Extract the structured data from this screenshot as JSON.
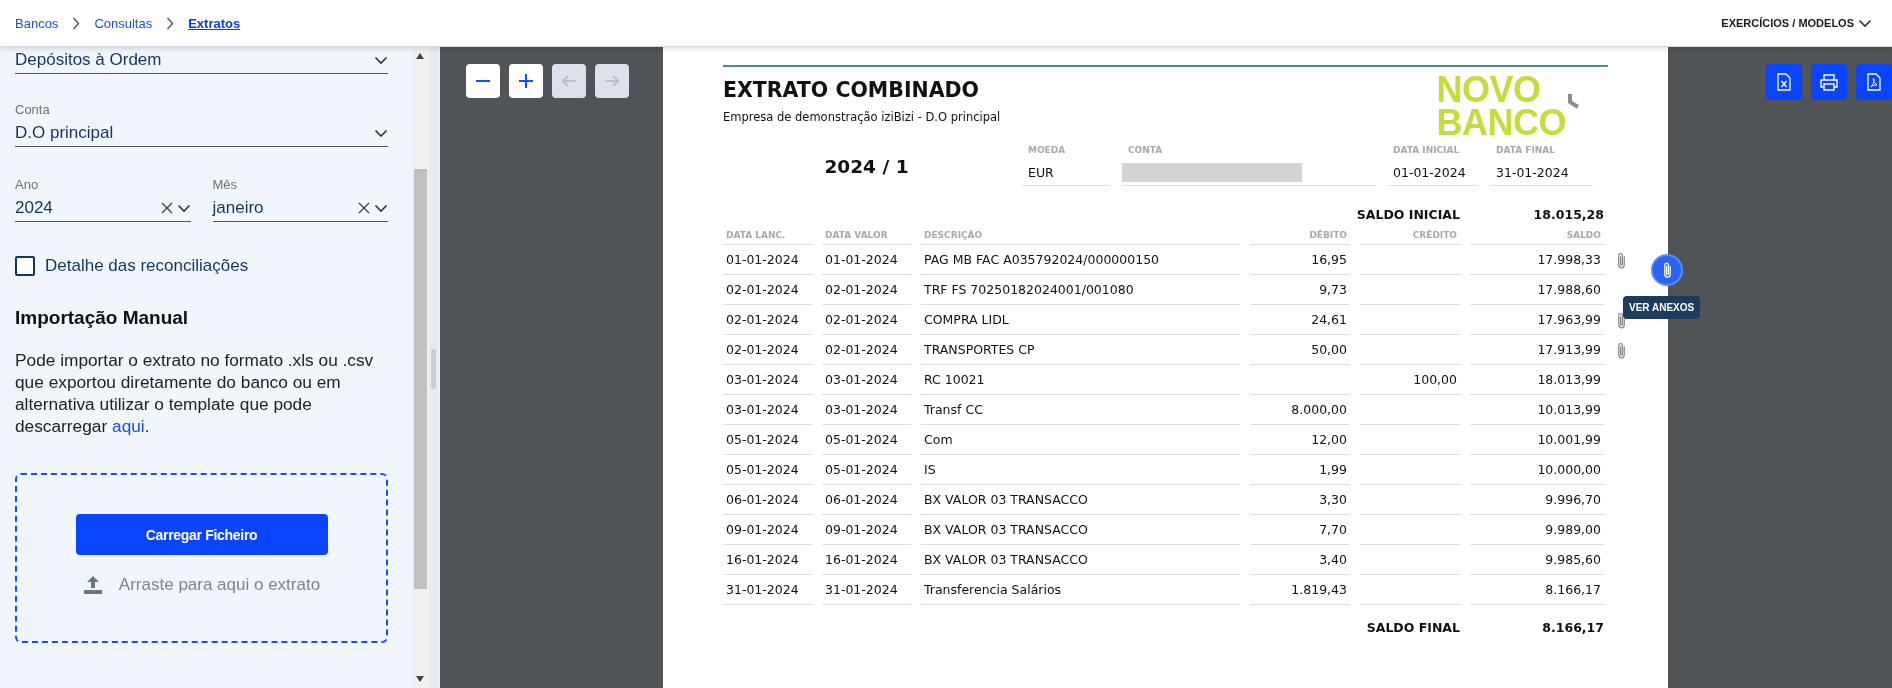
{
  "breadcrumb": [
    {
      "label": "Bancos",
      "selected": false
    },
    {
      "label": "Consultas",
      "selected": false
    },
    {
      "label": "Extratos",
      "selected": true
    }
  ],
  "top_menu": {
    "label": "EXERCÍCIOS / MODELOS"
  },
  "filters": {
    "account_type": {
      "value": "Depósitos à Ordem"
    },
    "account": {
      "label": "Conta",
      "value": "D.O principal"
    },
    "year": {
      "label": "Ano",
      "value": "2024"
    },
    "month": {
      "label": "Mês",
      "value": "janeiro"
    },
    "reconciliation_detail": {
      "label": "Detalhe das reconciliações",
      "checked": false
    }
  },
  "manual_import": {
    "heading": "Importação Manual",
    "text": "Pode importar o extrato no formato .xls ou .csv que exportou diretamente do banco ou em alternativa utilizar o template que pode descarregar ",
    "link": "aqui",
    "text_end": ".",
    "upload_button": "Carregar Ficheiro",
    "drop_hint": "Arraste para aqui o extrato"
  },
  "viewer_toolbar": [
    {
      "kind": "zoom-out",
      "disabled": false
    },
    {
      "kind": "zoom-in",
      "disabled": false
    },
    {
      "kind": "previous",
      "disabled": true
    },
    {
      "kind": "next",
      "disabled": true
    }
  ],
  "export_buttons": [
    {
      "kind": "excel"
    },
    {
      "kind": "print"
    },
    {
      "kind": "pdf"
    }
  ],
  "document": {
    "title": "EXTRATO COMBINADO",
    "subtitle": "Empresa de demonstração iziBizi - D.O principal",
    "logo": [
      "NOVO",
      "BANCO"
    ],
    "period": "2024 / 1",
    "meta": [
      {
        "label": "MOEDA",
        "value": "EUR"
      },
      {
        "label": "CONTA",
        "redacted": true
      },
      {
        "label": "DATA INICIAL",
        "value": "01-01-2024"
      },
      {
        "label": "DATA FINAL",
        "value": "31-01-2024"
      }
    ],
    "opening_balance": {
      "label": "SALDO INICIAL",
      "value": "18.015,28"
    },
    "columns": [
      "DATA LANC.",
      "DATA VALOR",
      "DESCRIÇÃO",
      "DÉBITO",
      "CRÉDITO",
      "SALDO"
    ],
    "rows": [
      {
        "cells": [
          "01-01-2024",
          "01-01-2024",
          "PAG MB FAC A035792024/000000150",
          "16,95",
          "",
          "17.998,33"
        ],
        "attachment": true
      },
      {
        "cells": [
          "02-01-2024",
          "02-01-2024",
          "TRF FS 70250182024001/001080",
          "9,73",
          "",
          "17.988,60"
        ],
        "attachment": false
      },
      {
        "cells": [
          "02-01-2024",
          "02-01-2024",
          "COMPRA LIDL",
          "24,61",
          "",
          "17.963,99"
        ],
        "attachment": true
      },
      {
        "cells": [
          "02-01-2024",
          "02-01-2024",
          "TRANSPORTES CP",
          "50,00",
          "",
          "17.913,99"
        ],
        "attachment": true
      },
      {
        "cells": [
          "03-01-2024",
          "03-01-2024",
          "RC 10021",
          "",
          "100,00",
          "18.013,99"
        ],
        "attachment": false
      },
      {
        "cells": [
          "03-01-2024",
          "03-01-2024",
          "Transf CC",
          "8.000,00",
          "",
          "10.013,99"
        ],
        "attachment": false
      },
      {
        "cells": [
          "05-01-2024",
          "05-01-2024",
          "Com",
          "12,00",
          "",
          "10.001,99"
        ],
        "attachment": false
      },
      {
        "cells": [
          "05-01-2024",
          "05-01-2024",
          "IS",
          "1,99",
          "",
          "10.000,00"
        ],
        "attachment": false
      },
      {
        "cells": [
          "06-01-2024",
          "06-01-2024",
          "BX VALOR 03 TRANSACCO",
          "3,30",
          "",
          "9.996,70"
        ],
        "attachment": false
      },
      {
        "cells": [
          "09-01-2024",
          "09-01-2024",
          "BX VALOR 03 TRANSACCO",
          "7,70",
          "",
          "9.989,00"
        ],
        "attachment": false
      },
      {
        "cells": [
          "16-01-2024",
          "16-01-2024",
          "BX VALOR 03 TRANSACCO",
          "3,40",
          "",
          "9.985,60"
        ],
        "attachment": false
      },
      {
        "cells": [
          "31-01-2024",
          "31-01-2024",
          "Transferencia Salários",
          "1.819,43",
          "",
          "8.166,17"
        ],
        "attachment": false
      }
    ],
    "closing_balance": {
      "label": "SALDO FINAL",
      "value": "8.166,17"
    }
  },
  "attach_button": {
    "tooltip": "VER ANEXOS"
  }
}
